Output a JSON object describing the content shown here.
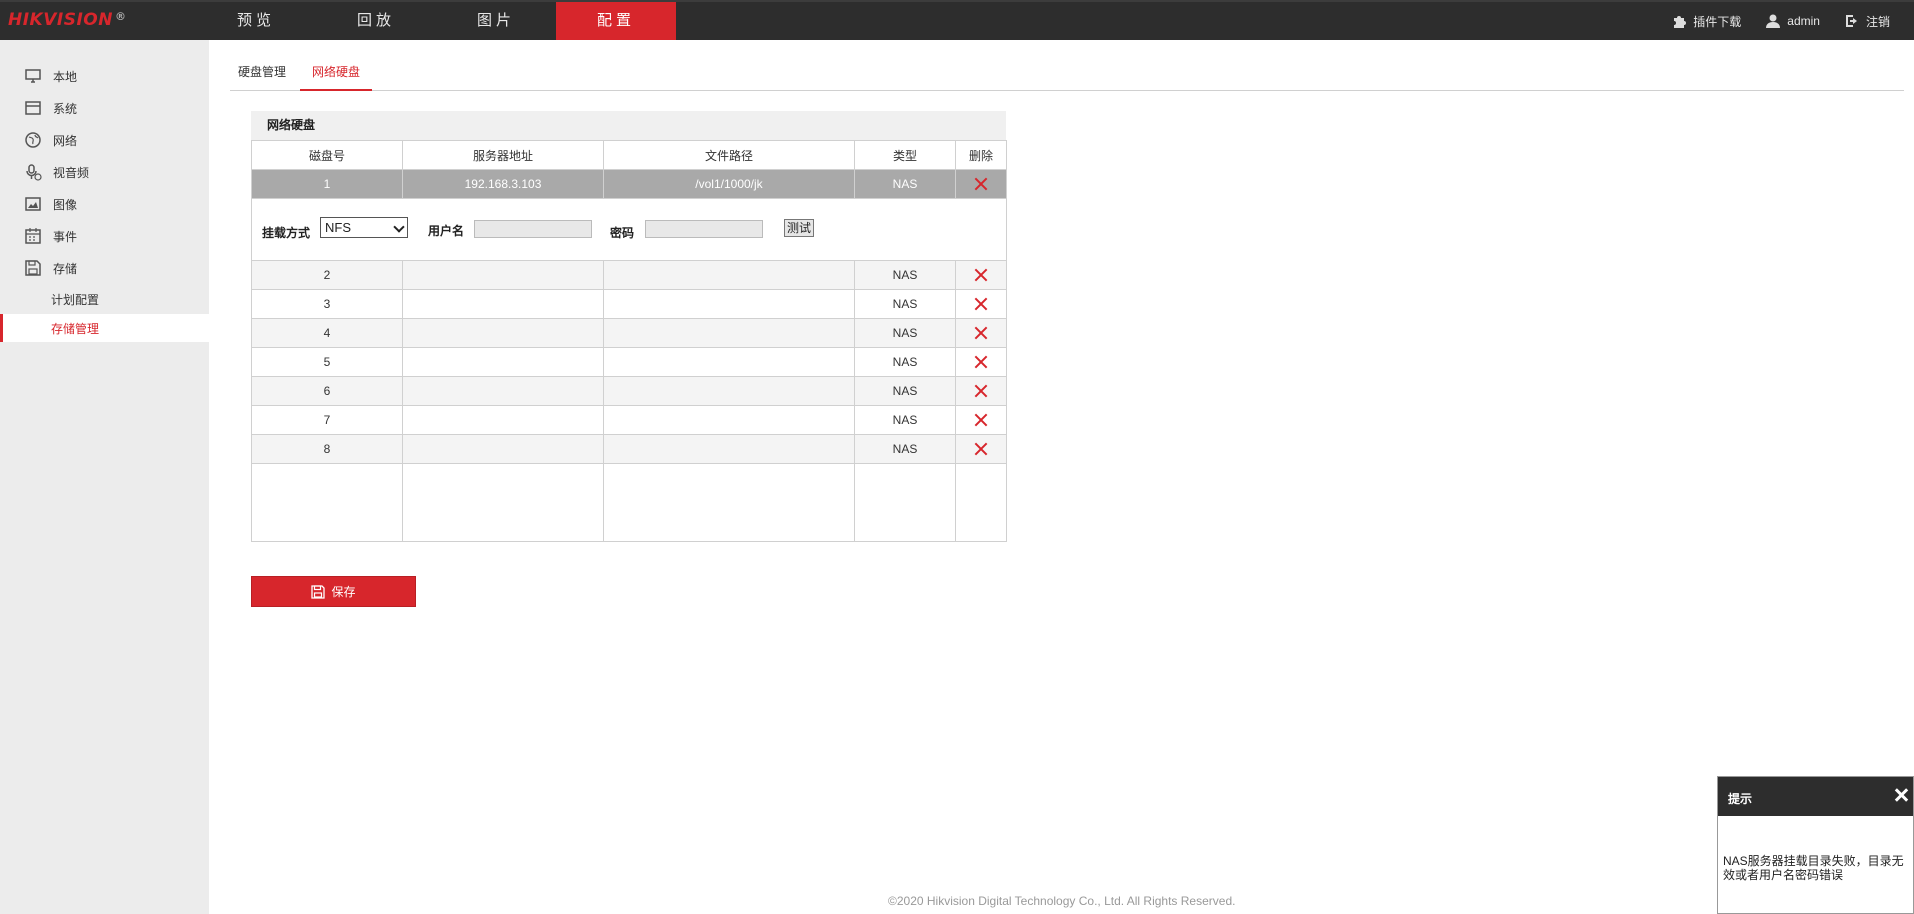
{
  "logo": {
    "brand_a": "HIK",
    "brand_b": "VISION",
    "mark": "®"
  },
  "nav": {
    "items": [
      {
        "label": "预览"
      },
      {
        "label": "回放"
      },
      {
        "label": "图片"
      },
      {
        "label": "配置"
      }
    ],
    "active": "配置"
  },
  "top_right": {
    "plugin_download": "插件下载",
    "user": "admin",
    "logout": "注销"
  },
  "sidebar": {
    "items": [
      {
        "label": "本地",
        "icon": "monitor-icon"
      },
      {
        "label": "系统",
        "icon": "system-icon"
      },
      {
        "label": "网络",
        "icon": "globe-icon"
      },
      {
        "label": "视音频",
        "icon": "microphone-icon"
      },
      {
        "label": "图像",
        "icon": "image-icon"
      },
      {
        "label": "事件",
        "icon": "calendar-icon"
      },
      {
        "label": "存储",
        "icon": "disk-icon"
      }
    ],
    "sub_items": [
      {
        "label": "计划配置"
      },
      {
        "label": "存储管理"
      }
    ],
    "active": "存储管理"
  },
  "tabs": {
    "items": [
      {
        "label": "硬盘管理"
      },
      {
        "label": "网络硬盘"
      }
    ],
    "active": "网络硬盘"
  },
  "panel": {
    "title": "网络硬盘",
    "columns": [
      "磁盘号",
      "服务器地址",
      "文件路径",
      "类型",
      "删除"
    ],
    "rows": [
      {
        "disk": "1",
        "server": "192.168.3.103",
        "path": "/vol1/1000/jk",
        "type": "NAS"
      },
      {
        "disk": "2",
        "server": "",
        "path": "",
        "type": "NAS"
      },
      {
        "disk": "3",
        "server": "",
        "path": "",
        "type": "NAS"
      },
      {
        "disk": "4",
        "server": "",
        "path": "",
        "type": "NAS"
      },
      {
        "disk": "5",
        "server": "",
        "path": "",
        "type": "NAS"
      },
      {
        "disk": "6",
        "server": "",
        "path": "",
        "type": "NAS"
      },
      {
        "disk": "7",
        "server": "",
        "path": "",
        "type": "NAS"
      },
      {
        "disk": "8",
        "server": "",
        "path": "",
        "type": "NAS"
      }
    ],
    "mount": {
      "method_label": "挂载方式",
      "method_value": "NFS",
      "username_label": "用户名",
      "username_value": "",
      "password_label": "密码",
      "password_value": "",
      "test_button": "测试"
    }
  },
  "save_button": "保存",
  "footer": "©2020 Hikvision Digital Technology Co., Ltd. All Rights Reserved.",
  "toast": {
    "title": "提示",
    "message": "NAS服务器挂载目录失败，目录无效或者用户名密码错误"
  },
  "colors": {
    "accent": "#d7262c",
    "topbar": "#2d2d2d",
    "sidebar": "#ececec",
    "selected_row": "#a9a9a9"
  }
}
